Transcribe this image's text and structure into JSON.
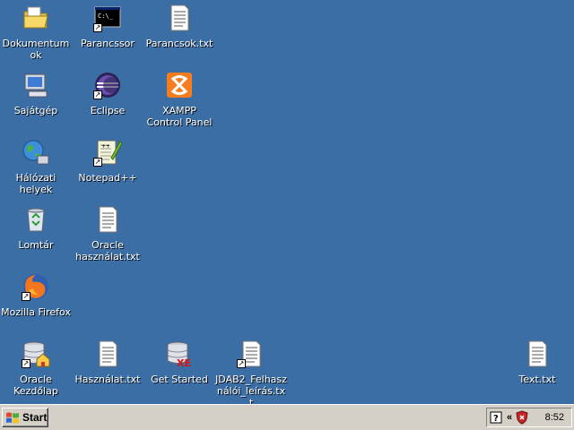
{
  "desktop_icons": [
    {
      "label": "Dokumentumok",
      "icon": "folder-icon"
    },
    {
      "label": "Parancssor",
      "icon": "command-prompt-icon"
    },
    {
      "label": "Parancsok.txt",
      "icon": "text-file-icon"
    },
    {
      "label": "Sajátgép",
      "icon": "my-computer-icon"
    },
    {
      "label": "Eclipse",
      "icon": "eclipse-icon"
    },
    {
      "label": "XAMPP Control Panel",
      "icon": "xampp-icon"
    },
    {
      "label": "Hálózati helyek",
      "icon": "network-places-icon"
    },
    {
      "label": "Notepad++",
      "icon": "notepad-plus-plus-icon"
    },
    {
      "label": "Lomtár",
      "icon": "recycle-bin-icon"
    },
    {
      "label": "Oracle használat.txt",
      "icon": "text-file-icon"
    },
    {
      "label": "Mozilla Firefox",
      "icon": "firefox-icon"
    },
    {
      "label": "Oracle Kezdőlap",
      "icon": "database-home-icon"
    },
    {
      "label": "Használat.txt",
      "icon": "text-file-icon"
    },
    {
      "label": "Get Started",
      "icon": "database-xe-icon"
    },
    {
      "label": "JDAB2_Felhasználói_leírás.txt",
      "icon": "text-file-icon"
    },
    {
      "label": "Text.txt",
      "icon": "text-file-icon"
    }
  ],
  "taskbar": {
    "start_label": "Start",
    "tray_collapse": "«",
    "clock": "8:52"
  },
  "colors": {
    "desktop": "#3a6ea5",
    "taskbar": "#d4d0c8"
  }
}
